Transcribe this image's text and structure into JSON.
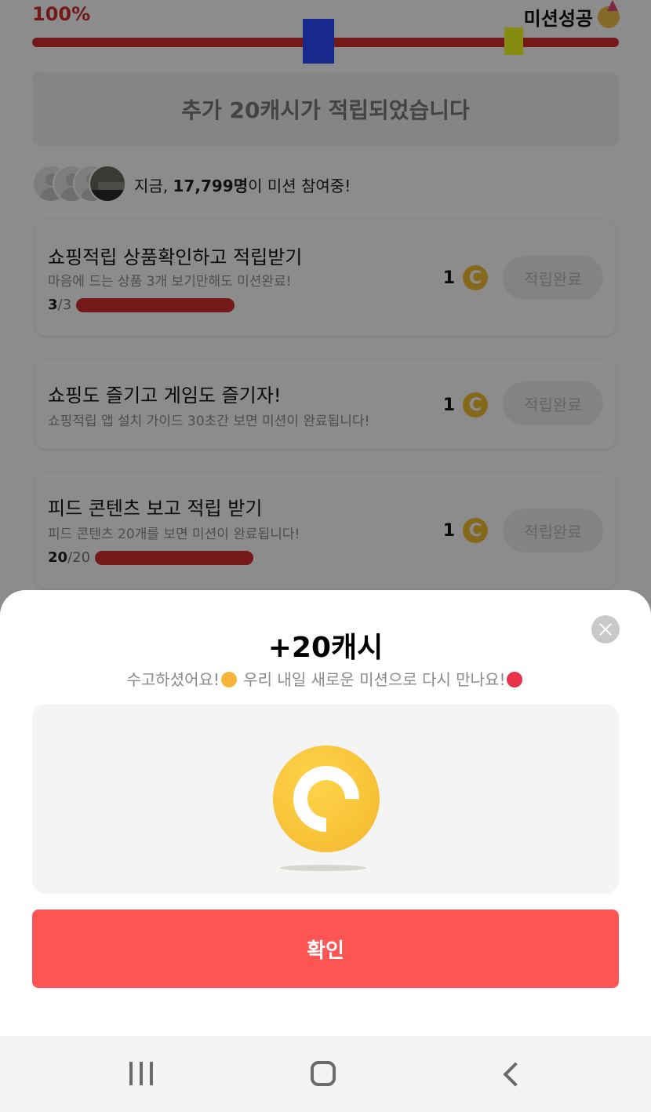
{
  "progress": {
    "percent_label": "100%",
    "percent_value": 100,
    "success_label": "미션성공",
    "party_icon": "party-popper-icon"
  },
  "notice": {
    "text": "추가 20캐시가 적립되었습니다"
  },
  "participants": {
    "prefix": "지금, ",
    "count": "17,799명",
    "suffix": "이 미션 참여중!"
  },
  "missions": [
    {
      "title": "쇼핑적립 상품확인하고 적립받기",
      "subtitle": "마음에 드는 상품 3개 보기만해도 미션완료!",
      "progress_current": "3",
      "progress_total": "/3",
      "progress_fraction": 1.0,
      "reward": "1",
      "coin_icon": "C",
      "button": "적립완료"
    },
    {
      "title": "쇼핑도 즐기고 게임도 즐기자!",
      "subtitle": "쇼핑적립 앱 설치 가이드 30초간 보면 미션이 완료됩니다!",
      "reward": "1",
      "coin_icon": "C",
      "button": "적립완료"
    },
    {
      "title": "피드 콘텐츠 보고 적립 받기",
      "subtitle": "피드 콘텐츠 20개를 보면 미션이 완료됩니다!",
      "progress_current": "20",
      "progress_total": "/20",
      "progress_fraction": 1.0,
      "reward": "1",
      "coin_icon": "C",
      "button": "적립완료"
    }
  ],
  "sheet": {
    "title": "+20캐시",
    "message_part1": "수고하셨어요!",
    "message_part2": " 우리 내일 새로운 미션으로 다시 만나요!",
    "confirm": "확인",
    "close_icon": "close-icon",
    "coin_icon": "coin-icon"
  },
  "colors": {
    "accent_red": "#d42e2e",
    "confirm_red": "#fd5454",
    "coin_gold": "#f3c032"
  }
}
